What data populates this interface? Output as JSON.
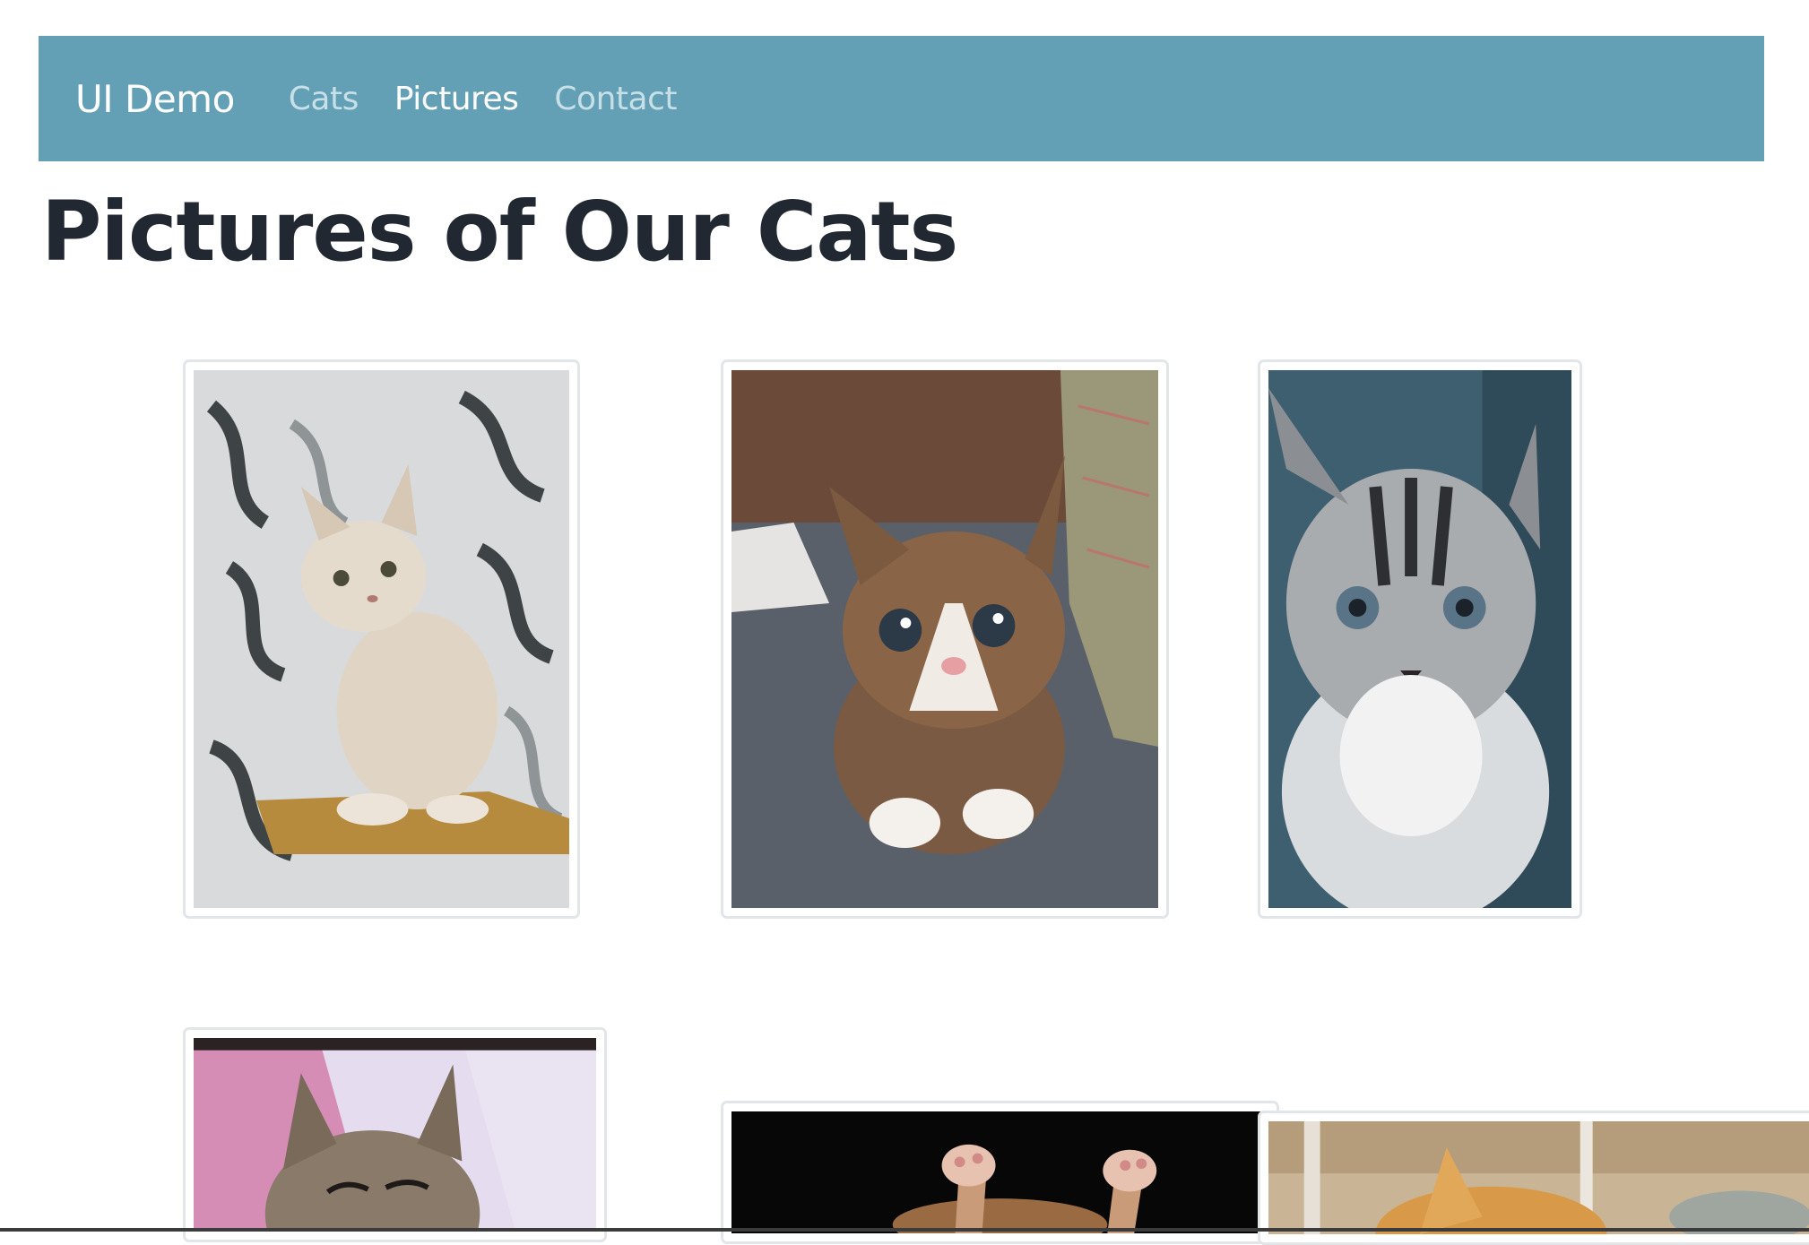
{
  "nav": {
    "brand": "UI Demo",
    "links": [
      {
        "label": "Cats",
        "active": false
      },
      {
        "label": "Pictures",
        "active": true
      },
      {
        "label": "Contact",
        "active": false
      }
    ]
  },
  "page": {
    "title": "Pictures of Our Cats"
  },
  "colors": {
    "navbar": "#63a0b6",
    "nav_active": "#ffffff",
    "nav_inactive": "#c7e0e8",
    "title": "#222831",
    "thumb_border": "#e3e6e8"
  },
  "gallery": {
    "images": [
      {
        "subject": "cream kitten sitting on a scratching shelf"
      },
      {
        "subject": "calico kitten crouching on floor"
      },
      {
        "subject": "grey tabby kitten close-up"
      },
      {
        "subject": "sleeping tabby kitten on pink blanket"
      },
      {
        "subject": "kitten paws up on black background"
      },
      {
        "subject": "ginger kitten blurred background"
      }
    ]
  }
}
